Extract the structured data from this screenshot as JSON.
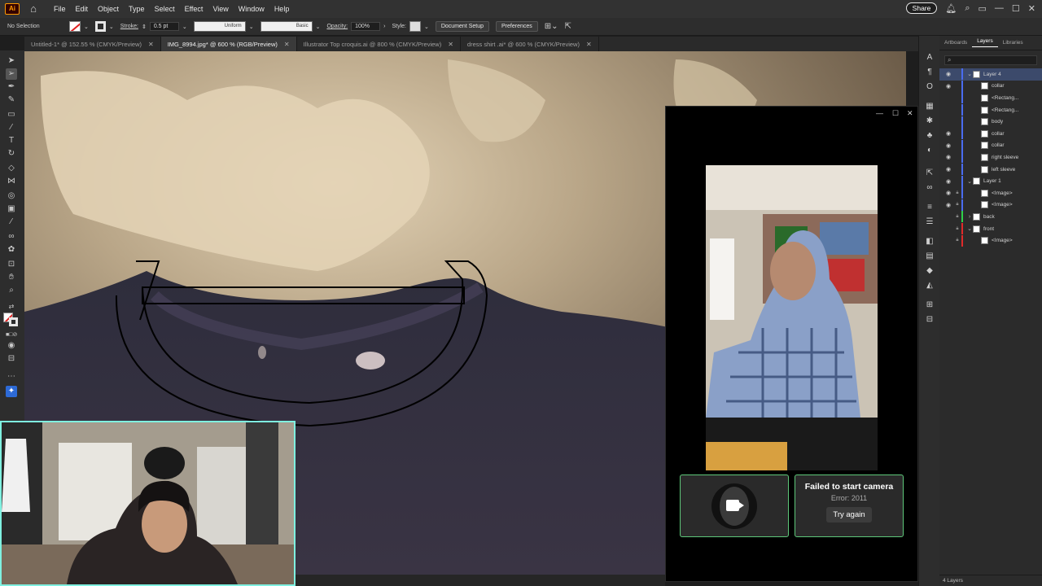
{
  "app": {
    "logo": "Ai",
    "menus": [
      "File",
      "Edit",
      "Object",
      "Type",
      "Select",
      "Effect",
      "View",
      "Window",
      "Help"
    ],
    "share_label": "Share"
  },
  "control_bar": {
    "selection": "No Selection",
    "stroke_label": "Stroke:",
    "stroke_value": "0.5 pt",
    "profile_value": "Uniform",
    "brush_value": "Basic",
    "opacity_label": "Opacity:",
    "opacity_value": "100%",
    "style_label": "Style:",
    "document_setup": "Document Setup",
    "preferences": "Preferences"
  },
  "tabs": [
    {
      "label": "Untitled-1* @ 152.55 % (CMYK/Preview)",
      "active": false
    },
    {
      "label": "IMG_8994.jpg* @ 600 % (RGB/Preview)",
      "active": true
    },
    {
      "label": "Illustrator Top croquis.ai @ 800 % (CMYK/Preview)",
      "active": false
    },
    {
      "label": "dress shirt .ai* @ 600 % (CMYK/Preview)",
      "active": false
    }
  ],
  "layers_panel": {
    "tabs": [
      "Artboards",
      "Layers",
      "Libraries"
    ],
    "active_tab": "Layers",
    "rows": [
      {
        "name": "Layer 4",
        "visible": true,
        "locked": false,
        "expanded": true,
        "indent": 0,
        "color": "#4a6cf0",
        "selected": true
      },
      {
        "name": "collar",
        "visible": true,
        "locked": false,
        "indent": 1,
        "color": "#4a6cf0"
      },
      {
        "name": "<Rectang...",
        "visible": false,
        "locked": false,
        "indent": 1,
        "color": "#4a6cf0"
      },
      {
        "name": "<Rectang...",
        "visible": false,
        "locked": false,
        "indent": 1,
        "color": "#4a6cf0"
      },
      {
        "name": "body",
        "visible": false,
        "locked": false,
        "indent": 1,
        "color": "#4a6cf0"
      },
      {
        "name": "collar",
        "visible": true,
        "locked": false,
        "indent": 1,
        "color": "#4a6cf0"
      },
      {
        "name": "collar",
        "visible": true,
        "locked": false,
        "indent": 1,
        "color": "#4a6cf0"
      },
      {
        "name": "right sleeve",
        "visible": true,
        "locked": false,
        "indent": 1,
        "color": "#4a6cf0"
      },
      {
        "name": "left sleeve",
        "visible": true,
        "locked": false,
        "indent": 1,
        "color": "#4a6cf0"
      },
      {
        "name": "Layer 1",
        "visible": true,
        "locked": false,
        "expanded": true,
        "indent": 0,
        "color": "#4a6cf0"
      },
      {
        "name": "<Image>",
        "visible": true,
        "locked": true,
        "indent": 1,
        "color": "#4a6cf0"
      },
      {
        "name": "<Image>",
        "visible": true,
        "locked": true,
        "indent": 1,
        "color": "#4a6cf0"
      },
      {
        "name": "back",
        "visible": false,
        "locked": true,
        "expanded": false,
        "indent": 0,
        "color": "#2fd04a"
      },
      {
        "name": "front",
        "visible": false,
        "locked": true,
        "expanded": true,
        "indent": 0,
        "color": "#e02a2a"
      },
      {
        "name": "<Image>",
        "visible": false,
        "locked": true,
        "indent": 1,
        "color": "#e02a2a"
      }
    ],
    "footer": "4 Layers"
  },
  "camera_window": {
    "failed_title": "Failed to start camera",
    "error_text": "Error: 2011",
    "try_again": "Try again"
  }
}
